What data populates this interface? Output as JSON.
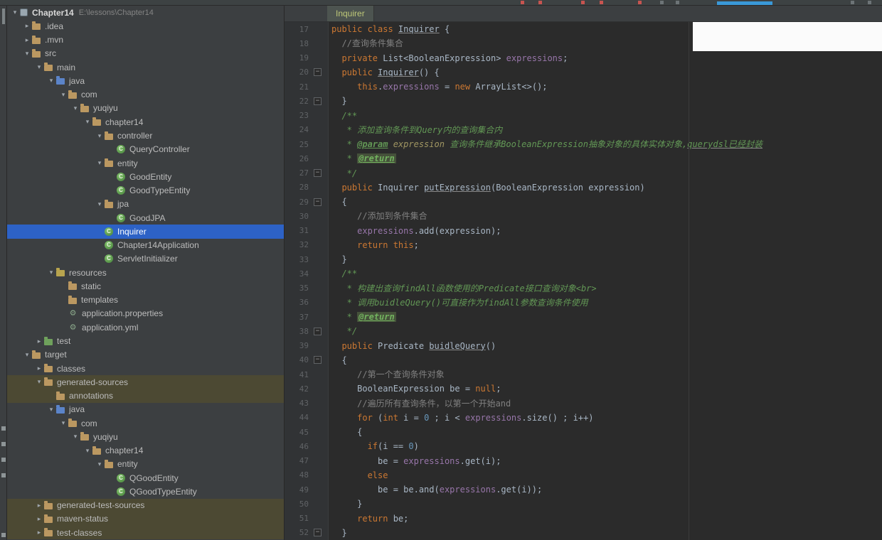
{
  "colors": {
    "selection_blue": "#2d62c6",
    "generated_row_bg": "#4c4933",
    "editor_bg": "#2b2b2b",
    "panel_bg": "#3c3f41",
    "keyword_orange": "#cc7832",
    "field_purple": "#9876aa",
    "doc_green": "#629755",
    "number_blue": "#6897bb"
  },
  "project_panel": {
    "items": [
      {
        "label": "Chapter14",
        "path": "E:\\lessons\\Chapter14",
        "level": 0,
        "arrow": "expanded",
        "icon": "project",
        "root": true
      },
      {
        "label": ".idea",
        "level": 1,
        "arrow": "collapsed",
        "icon": "folder"
      },
      {
        "label": ".mvn",
        "level": 1,
        "arrow": "collapsed",
        "icon": "folder"
      },
      {
        "label": "src",
        "level": 1,
        "arrow": "expanded",
        "icon": "folder"
      },
      {
        "label": "main",
        "level": 2,
        "arrow": "expanded",
        "icon": "folder"
      },
      {
        "label": "java",
        "level": 3,
        "arrow": "expanded",
        "icon": "folder-java"
      },
      {
        "label": "com",
        "level": 4,
        "arrow": "expanded",
        "icon": "folder"
      },
      {
        "label": "yuqiyu",
        "level": 5,
        "arrow": "expanded",
        "icon": "folder"
      },
      {
        "label": "chapter14",
        "level": 6,
        "arrow": "expanded",
        "icon": "folder"
      },
      {
        "label": "controller",
        "level": 7,
        "arrow": "expanded",
        "icon": "folder"
      },
      {
        "label": "QueryController",
        "level": 8,
        "arrow": null,
        "icon": "class"
      },
      {
        "label": "entity",
        "level": 7,
        "arrow": "expanded",
        "icon": "folder"
      },
      {
        "label": "GoodEntity",
        "level": 8,
        "arrow": null,
        "icon": "class"
      },
      {
        "label": "GoodTypeEntity",
        "level": 8,
        "arrow": null,
        "icon": "class"
      },
      {
        "label": "jpa",
        "level": 7,
        "arrow": "expanded",
        "icon": "folder"
      },
      {
        "label": "GoodJPA",
        "level": 8,
        "arrow": null,
        "icon": "class"
      },
      {
        "label": "Inquirer",
        "level": 7,
        "arrow": null,
        "icon": "class",
        "selected": true
      },
      {
        "label": "Chapter14Application",
        "level": 7,
        "arrow": null,
        "icon": "class"
      },
      {
        "label": "ServletInitializer",
        "level": 7,
        "arrow": null,
        "icon": "class"
      },
      {
        "label": "resources",
        "level": 3,
        "arrow": "expanded",
        "icon": "folder-res"
      },
      {
        "label": "static",
        "level": 4,
        "arrow": null,
        "icon": "folder"
      },
      {
        "label": "templates",
        "level": 4,
        "arrow": null,
        "icon": "folder"
      },
      {
        "label": "application.properties",
        "level": 4,
        "arrow": null,
        "icon": "gear"
      },
      {
        "label": "application.yml",
        "level": 4,
        "arrow": null,
        "icon": "gear"
      },
      {
        "label": "test",
        "level": 2,
        "arrow": "collapsed",
        "icon": "folder-test"
      },
      {
        "label": "target",
        "level": 1,
        "arrow": "expanded",
        "icon": "folder"
      },
      {
        "label": "classes",
        "level": 2,
        "arrow": "collapsed",
        "icon": "folder"
      },
      {
        "label": "generated-sources",
        "level": 2,
        "arrow": "expanded",
        "icon": "folder",
        "gen": true
      },
      {
        "label": "annotations",
        "level": 3,
        "arrow": null,
        "icon": "folder",
        "gen": true
      },
      {
        "label": "java",
        "level": 3,
        "arrow": "expanded",
        "icon": "folder-java"
      },
      {
        "label": "com",
        "level": 4,
        "arrow": "expanded",
        "icon": "folder"
      },
      {
        "label": "yuqiyu",
        "level": 5,
        "arrow": "expanded",
        "icon": "folder"
      },
      {
        "label": "chapter14",
        "level": 6,
        "arrow": "expanded",
        "icon": "folder"
      },
      {
        "label": "entity",
        "level": 7,
        "arrow": "expanded",
        "icon": "folder"
      },
      {
        "label": "QGoodEntity",
        "level": 8,
        "arrow": null,
        "icon": "class"
      },
      {
        "label": "QGoodTypeEntity",
        "level": 8,
        "arrow": null,
        "icon": "class"
      },
      {
        "label": "generated-test-sources",
        "level": 2,
        "arrow": "collapsed",
        "icon": "folder",
        "gen": true
      },
      {
        "label": "maven-status",
        "level": 2,
        "arrow": "collapsed",
        "icon": "folder",
        "gen": true
      },
      {
        "label": "test-classes",
        "level": 2,
        "arrow": "collapsed",
        "icon": "folder",
        "gen": true
      }
    ]
  },
  "editor": {
    "tab_label": "Inquirer",
    "lines": [
      {
        "n": 17,
        "fold": null,
        "s": [
          [
            "kw",
            "public class "
          ],
          [
            "plain-u",
            "Inquirer"
          ],
          [
            "plain",
            " {"
          ]
        ]
      },
      {
        "n": 18,
        "fold": null,
        "s": [
          [
            "comment",
            "  //查询条件集合"
          ]
        ]
      },
      {
        "n": 19,
        "fold": null,
        "s": [
          [
            "kw",
            "  private "
          ],
          [
            "plain",
            "List<BooleanExpression> "
          ],
          [
            "field",
            "expressions"
          ],
          [
            "plain",
            ";"
          ]
        ]
      },
      {
        "n": 20,
        "fold": "start",
        "s": [
          [
            "kw",
            "  public "
          ],
          [
            "plain-u",
            "Inquirer"
          ],
          [
            "plain",
            "() {"
          ]
        ]
      },
      {
        "n": 21,
        "fold": null,
        "s": [
          [
            "plain",
            "     "
          ],
          [
            "kw",
            "this"
          ],
          [
            "plain",
            "."
          ],
          [
            "field",
            "expressions"
          ],
          [
            "plain",
            " = "
          ],
          [
            "kw",
            "new "
          ],
          [
            "plain",
            "ArrayList<>();"
          ]
        ]
      },
      {
        "n": 22,
        "fold": "end",
        "s": [
          [
            "plain",
            "  }"
          ]
        ]
      },
      {
        "n": 23,
        "fold": null,
        "s": [
          [
            "doc",
            "  /**"
          ]
        ]
      },
      {
        "n": 24,
        "fold": null,
        "s": [
          [
            "doc",
            "   * 添加查询条件到Query内的查询集合内"
          ]
        ]
      },
      {
        "n": 25,
        "fold": null,
        "s": [
          [
            "doc",
            "   * "
          ],
          [
            "doctag",
            "@param"
          ],
          [
            "docval",
            " expression "
          ],
          [
            "doc",
            "查询条件继承BooleanExpression抽象对象的具体实体对象,"
          ],
          [
            "doc-u",
            "querydsl已经封装"
          ]
        ]
      },
      {
        "n": 26,
        "fold": null,
        "s": [
          [
            "doc",
            "   * "
          ],
          [
            "docret",
            "@return"
          ]
        ]
      },
      {
        "n": 27,
        "fold": "end",
        "s": [
          [
            "doc",
            "   */"
          ]
        ]
      },
      {
        "n": 28,
        "fold": null,
        "s": [
          [
            "kw",
            "  public "
          ],
          [
            "plain",
            "Inquirer "
          ],
          [
            "plain-u",
            "putExpression"
          ],
          [
            "plain",
            "(BooleanExpression expression)"
          ]
        ]
      },
      {
        "n": 29,
        "fold": "start",
        "s": [
          [
            "plain",
            "  {"
          ]
        ]
      },
      {
        "n": 30,
        "fold": null,
        "s": [
          [
            "comment",
            "     //添加到条件集合"
          ]
        ]
      },
      {
        "n": 31,
        "fold": null,
        "s": [
          [
            "plain",
            "     "
          ],
          [
            "field",
            "expressions"
          ],
          [
            "plain",
            ".add(expression);"
          ]
        ]
      },
      {
        "n": 32,
        "fold": null,
        "s": [
          [
            "plain",
            "     "
          ],
          [
            "kw",
            "return this"
          ],
          [
            "plain",
            ";"
          ]
        ]
      },
      {
        "n": 33,
        "fold": null,
        "s": [
          [
            "plain",
            "  }"
          ]
        ]
      },
      {
        "n": 34,
        "fold": null,
        "s": [
          [
            "doc",
            "  /**"
          ]
        ]
      },
      {
        "n": 35,
        "fold": null,
        "s": [
          [
            "doc",
            "   * 构建出查询findAll函数使用的Predicate接口查询对象<br>"
          ]
        ]
      },
      {
        "n": 36,
        "fold": null,
        "s": [
          [
            "doc",
            "   * 调用buidleQuery()可直接作为findAll参数查询条件使用"
          ]
        ]
      },
      {
        "n": 37,
        "fold": null,
        "s": [
          [
            "doc",
            "   * "
          ],
          [
            "docret",
            "@return"
          ]
        ]
      },
      {
        "n": 38,
        "fold": "end",
        "s": [
          [
            "doc",
            "   */"
          ]
        ]
      },
      {
        "n": 39,
        "fold": null,
        "s": [
          [
            "kw",
            "  public "
          ],
          [
            "plain",
            "Predicate "
          ],
          [
            "plain-u",
            "buidleQuery"
          ],
          [
            "plain",
            "()"
          ]
        ]
      },
      {
        "n": 40,
        "fold": "start",
        "s": [
          [
            "plain",
            "  {"
          ]
        ]
      },
      {
        "n": 41,
        "fold": null,
        "s": [
          [
            "comment",
            "     //第一个查询条件对象"
          ]
        ]
      },
      {
        "n": 42,
        "fold": null,
        "s": [
          [
            "plain",
            "     BooleanExpression be = "
          ],
          [
            "kw",
            "null"
          ],
          [
            "plain",
            ";"
          ]
        ]
      },
      {
        "n": 43,
        "fold": null,
        "s": [
          [
            "comment",
            "     //遍历所有查询条件，以第一个开始and"
          ]
        ]
      },
      {
        "n": 44,
        "fold": null,
        "s": [
          [
            "plain",
            "     "
          ],
          [
            "kw",
            "for "
          ],
          [
            "plain",
            "("
          ],
          [
            "kw",
            "int "
          ],
          [
            "plain",
            "i = "
          ],
          [
            "num",
            "0"
          ],
          [
            "plain",
            " ; i < "
          ],
          [
            "field",
            "expressions"
          ],
          [
            "plain",
            ".size() ; i++)"
          ]
        ]
      },
      {
        "n": 45,
        "fold": null,
        "s": [
          [
            "plain",
            "     {"
          ]
        ]
      },
      {
        "n": 46,
        "fold": null,
        "s": [
          [
            "plain",
            "       "
          ],
          [
            "kw",
            "if"
          ],
          [
            "plain",
            "(i == "
          ],
          [
            "num",
            "0"
          ],
          [
            "plain",
            ")"
          ]
        ]
      },
      {
        "n": 47,
        "fold": null,
        "s": [
          [
            "plain",
            "         be = "
          ],
          [
            "field",
            "expressions"
          ],
          [
            "plain",
            ".get(i);"
          ]
        ]
      },
      {
        "n": 48,
        "fold": null,
        "s": [
          [
            "plain",
            "       "
          ],
          [
            "kw",
            "else"
          ]
        ]
      },
      {
        "n": 49,
        "fold": null,
        "s": [
          [
            "plain",
            "         be = be.and("
          ],
          [
            "field",
            "expressions"
          ],
          [
            "plain",
            ".get(i));"
          ]
        ]
      },
      {
        "n": 50,
        "fold": null,
        "s": [
          [
            "plain",
            "     }"
          ]
        ]
      },
      {
        "n": 51,
        "fold": null,
        "s": [
          [
            "plain",
            "     "
          ],
          [
            "kw",
            "return "
          ],
          [
            "plain",
            "be;"
          ]
        ]
      },
      {
        "n": 52,
        "fold": "end",
        "s": [
          [
            "plain",
            "  }"
          ]
        ]
      }
    ]
  }
}
